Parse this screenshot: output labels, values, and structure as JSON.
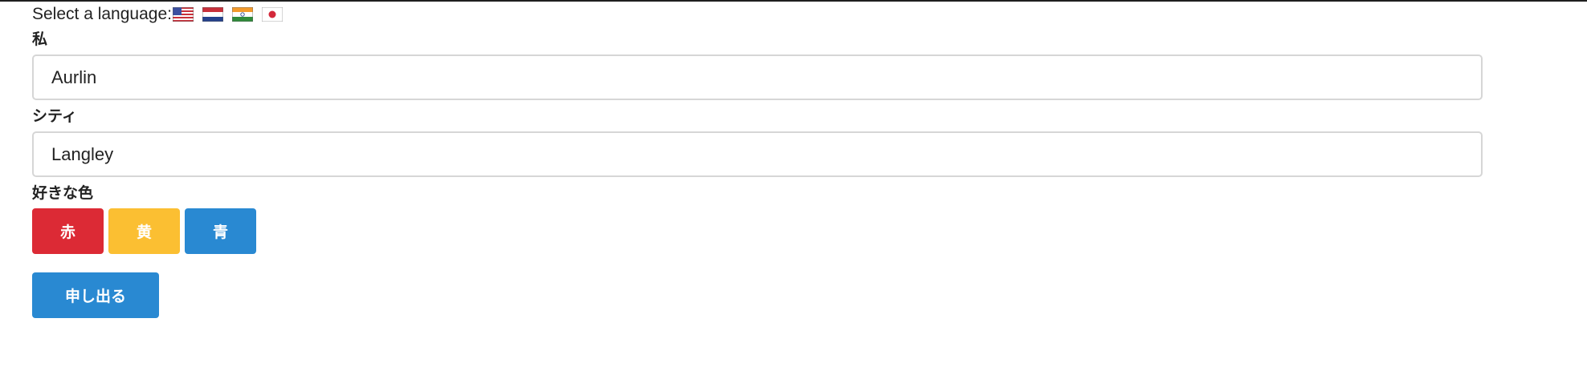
{
  "language_selector": {
    "label": "Select a language:",
    "flags": [
      {
        "icon": "us-flag-icon"
      },
      {
        "icon": "netherlands-flag-icon"
      },
      {
        "icon": "india-flag-icon"
      },
      {
        "icon": "japan-flag-icon"
      }
    ]
  },
  "form": {
    "name_label": "私",
    "name_value": "Aurlin",
    "city_label": "シティ",
    "city_value": "Langley",
    "color_label": "好きな色",
    "colors": [
      {
        "label": "赤",
        "color": "#dc2a35"
      },
      {
        "label": "黄",
        "color": "#fbbf32"
      },
      {
        "label": "青",
        "color": "#2989d2"
      }
    ],
    "submit_label": "申し出る",
    "submit_color": "#2989d2"
  }
}
